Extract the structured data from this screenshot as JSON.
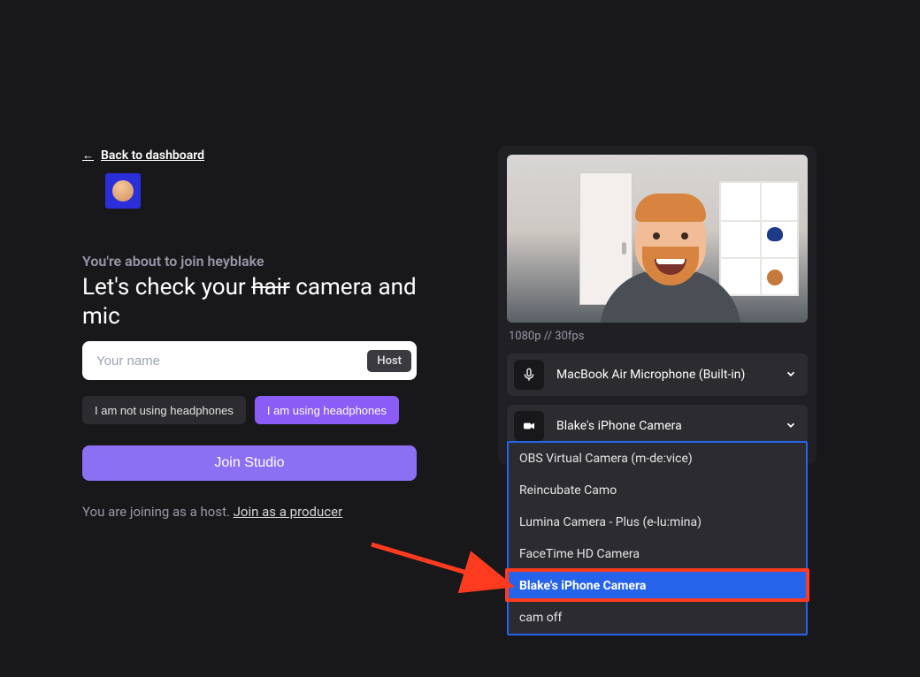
{
  "nav": {
    "back_label": "Back to dashboard",
    "back_arrow": "←"
  },
  "join": {
    "subtitle": "You're about to join heyblake",
    "headline_pre": "Let's check your ",
    "headline_strike": "hair",
    "headline_post": " camera and mic"
  },
  "name_field": {
    "placeholder": "Your name",
    "badge": "Host",
    "value": ""
  },
  "headphones": {
    "off_label": "I am not using headphones",
    "on_label": "I am using headphones"
  },
  "cta": {
    "join_label": "Join Studio"
  },
  "role_line": {
    "prefix": "You are joining as a host. ",
    "link": "Join as a producer"
  },
  "stream": {
    "meta": "1080p // 30fps"
  },
  "devices": {
    "mic": {
      "label": "MacBook Air Microphone (Built-in)"
    },
    "camera": {
      "label": "Blake's iPhone Camera"
    }
  },
  "camera_options": [
    {
      "label": "OBS Virtual Camera (m-de:vice)",
      "selected": false
    },
    {
      "label": "Reincubate Camo",
      "selected": false
    },
    {
      "label": "Lumina Camera - Plus (e-lu:mina)",
      "selected": false
    },
    {
      "label": "FaceTime HD Camera",
      "selected": false
    },
    {
      "label": "Blake's iPhone Camera",
      "selected": true
    },
    {
      "label": "cam off",
      "selected": false
    }
  ]
}
